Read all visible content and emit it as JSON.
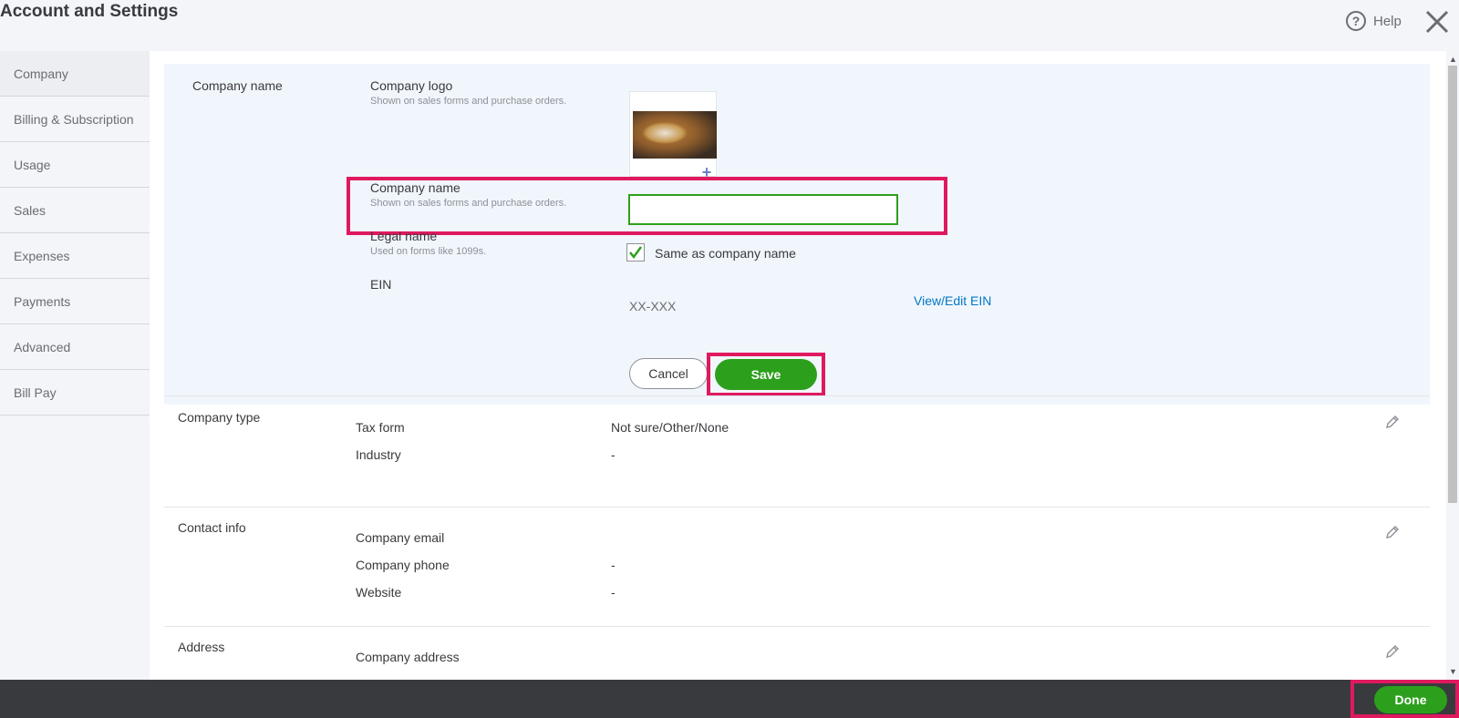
{
  "header": {
    "title": "Account and Settings",
    "help_label": "Help",
    "help_icon": "help-icon",
    "close_icon": "close-icon"
  },
  "sidebar": {
    "items": [
      {
        "label": "Company",
        "active": true
      },
      {
        "label": "Billing & Subscription"
      },
      {
        "label": "Usage"
      },
      {
        "label": "Sales"
      },
      {
        "label": "Expenses"
      },
      {
        "label": "Payments"
      },
      {
        "label": "Advanced"
      },
      {
        "label": "Bill Pay"
      }
    ]
  },
  "company_name_section": {
    "title": "Company name",
    "logo": {
      "label": "Company logo",
      "sub": "Shown on sales forms and purchase orders."
    },
    "name": {
      "label": "Company name",
      "sub": "Shown on sales forms and purchase orders.",
      "value": "",
      "placeholder": ""
    },
    "legal": {
      "label": "Legal name",
      "sub": "Used on forms like 1099s.",
      "checkbox_label": "Same as company name",
      "checked": true
    },
    "ein": {
      "label": "EIN",
      "value": "XX-XXX",
      "link": "View/Edit EIN"
    },
    "cancel_label": "Cancel",
    "save_label": "Save"
  },
  "company_type_section": {
    "title": "Company type",
    "rows": [
      {
        "label": "Tax form",
        "value": "Not sure/Other/None"
      },
      {
        "label": "Industry",
        "value": "-"
      }
    ]
  },
  "contact_section": {
    "title": "Contact info",
    "rows": [
      {
        "label": "Company email",
        "value": ""
      },
      {
        "label": "Company phone",
        "value": "-"
      },
      {
        "label": "Website",
        "value": "-"
      }
    ]
  },
  "address_section": {
    "title": "Address",
    "rows": [
      {
        "label": "Company address",
        "value": ""
      }
    ]
  },
  "footer": {
    "done_label": "Done"
  },
  "colors": {
    "accent_green": "#2ca01c",
    "highlight": "#e0195f",
    "link": "#0077c5",
    "footer_bg": "#393a3d"
  }
}
